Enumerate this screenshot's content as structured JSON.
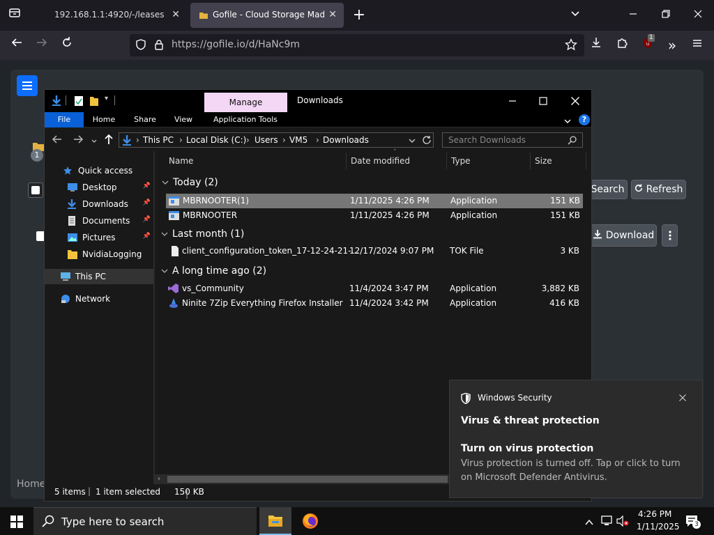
{
  "browser": {
    "tabs": [
      {
        "label": "192.168.1.1:4920/-/leases"
      },
      {
        "label": "Gofile - Cloud Storage Made Simple"
      }
    ],
    "url": "https://gofile.io/d/HaNc9m",
    "extension_badge": "1"
  },
  "webpage": {
    "status_circle": "1",
    "search_label": "Search",
    "refresh_label": "Refresh",
    "download_label": "Download",
    "footer_text": "Home"
  },
  "explorer": {
    "title": "Downloads",
    "context_tab": "Manage",
    "ribbon_tabs": [
      "File",
      "Home",
      "Share",
      "View",
      "Application Tools"
    ],
    "breadcrumb": [
      "This PC",
      "Local Disk (C:)",
      "Users",
      "VM5",
      "Downloads"
    ],
    "search_placeholder": "Search Downloads",
    "nav_items": [
      {
        "label": "Quick access",
        "icon": "star-icon"
      },
      {
        "label": "Desktop",
        "icon": "desktop-icon",
        "pinned": true
      },
      {
        "label": "Downloads",
        "icon": "download-icon",
        "pinned": true
      },
      {
        "label": "Documents",
        "icon": "document-icon",
        "pinned": true
      },
      {
        "label": "Pictures",
        "icon": "pictures-icon",
        "pinned": true
      },
      {
        "label": "NvidiaLogging",
        "icon": "folder-icon"
      },
      {
        "label": "This PC",
        "icon": "computer-icon"
      },
      {
        "label": "Network",
        "icon": "network-icon"
      }
    ],
    "columns": [
      "Name",
      "Date modified",
      "Type",
      "Size"
    ],
    "groups": [
      {
        "label": "Today (2)"
      },
      {
        "label": "Last month (1)"
      },
      {
        "label": "A long time ago (2)"
      }
    ],
    "files": [
      {
        "name": "MBRNOOTER(1)",
        "date": "1/11/2025 4:26 PM",
        "type": "Application",
        "size": "151 KB"
      },
      {
        "name": "MBRNOOTER",
        "date": "1/11/2025 4:26 PM",
        "type": "Application",
        "size": "151 KB"
      },
      {
        "name": "client_configuration_token_17-12-24-21-...",
        "date": "12/17/2024 9:07 PM",
        "type": "TOK File",
        "size": "3 KB"
      },
      {
        "name": "vs_Community",
        "date": "11/4/2024 3:47 PM",
        "type": "Application",
        "size": "3,882 KB"
      },
      {
        "name": "Ninite 7Zip Everything Firefox Installer",
        "date": "11/4/2024 3:42 PM",
        "type": "Application",
        "size": "416 KB"
      }
    ],
    "status": {
      "items": "5 items",
      "selected": "1 item selected",
      "size": "150 KB"
    }
  },
  "toast": {
    "app": "Windows Security",
    "heading": "Virus & threat protection",
    "title": "Turn on virus protection",
    "body": "Virus protection is turned off. Tap or click to turn on Microsoft Defender Antivirus."
  },
  "taskbar": {
    "search_placeholder": "Type here to search",
    "time": "4:26 PM",
    "date": "1/11/2025",
    "notification_count": "3"
  },
  "colors": {
    "accent": "#0a60d6",
    "manage_tab": "#f4d7f5",
    "selection": "#777777"
  }
}
